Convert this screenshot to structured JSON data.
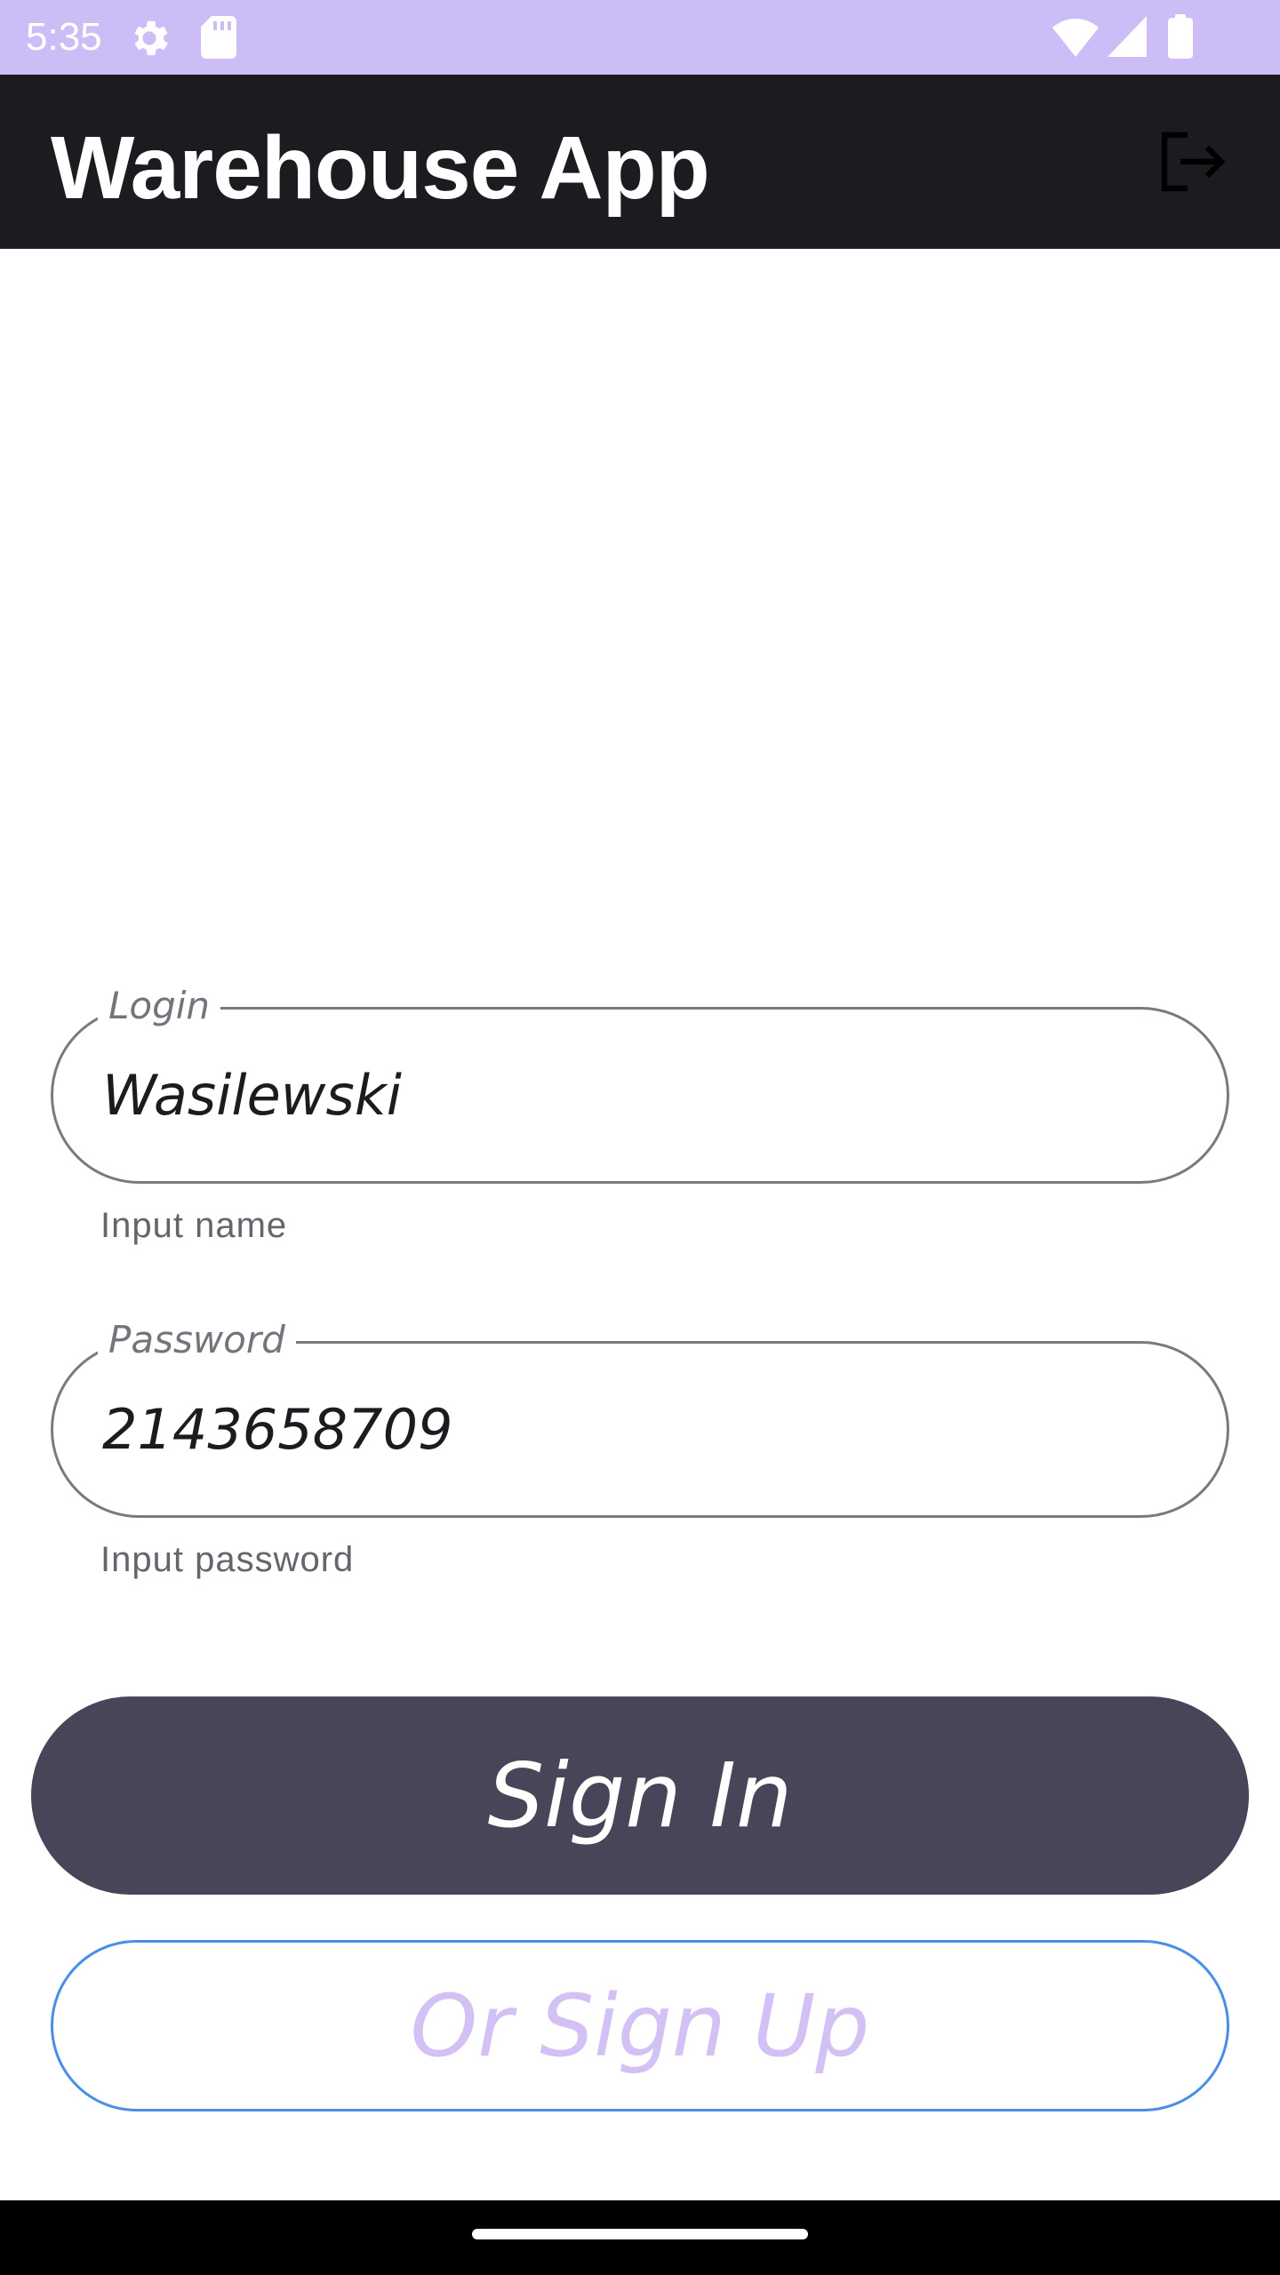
{
  "status_bar": {
    "time": "5:35",
    "icons": [
      "settings-gear-icon",
      "sd-card-icon",
      "wifi-icon",
      "cellular-signal-icon",
      "battery-icon"
    ],
    "background": "#cdbdf7"
  },
  "app_bar": {
    "title": "Warehouse App",
    "action_icon": "logout-icon",
    "background": "#1d1b20"
  },
  "form": {
    "login": {
      "label": "Login",
      "value": "Wasilewski",
      "helper": "Input name"
    },
    "password": {
      "label": "Password",
      "value": "2143658709",
      "helper": "Input password"
    }
  },
  "buttons": {
    "sign_in": "Sign In",
    "sign_up": "Or Sign Up"
  },
  "colors": {
    "primary_button": "#4a4458",
    "secondary_button_border": "#4a8ee6",
    "secondary_button_text": "#d3c0f5",
    "field_border": "#7a7880"
  }
}
